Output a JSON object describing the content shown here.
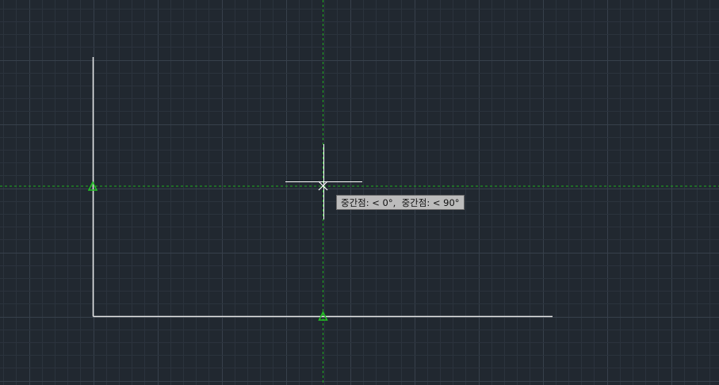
{
  "viewport": {
    "background_color": "#212830",
    "grid_minor_color": "#2b333d",
    "grid_major_color": "#37404b",
    "geometry_color": "#e6e6e6",
    "tracking_line_color": "#1fae1f",
    "snap_marker_color": "#22c322",
    "crosshair_color": "#ffffff"
  },
  "tooltip": {
    "text": "중간점: < 0°,  중간점: < 90°"
  }
}
